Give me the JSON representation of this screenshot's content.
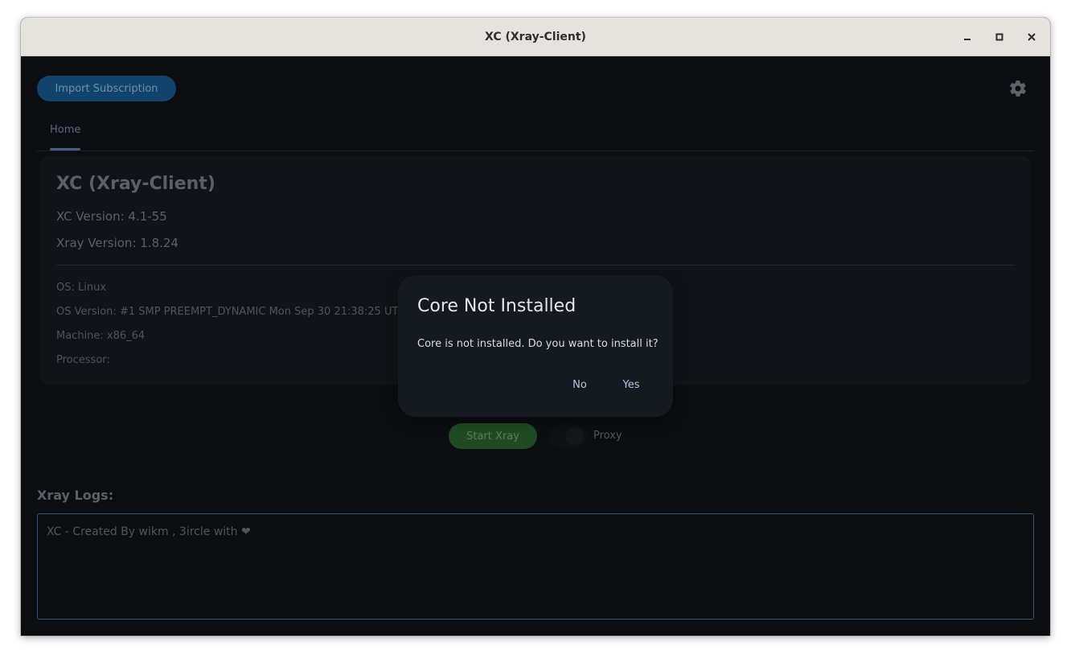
{
  "window": {
    "title": "XC (Xray-Client)"
  },
  "toolbar": {
    "import_label": "Import Subscription",
    "settings_icon": "gear-icon"
  },
  "tabs": [
    {
      "label": "Home",
      "active": true
    }
  ],
  "info_card": {
    "title": "XC (Xray-Client)",
    "xc_version": "XC Version: 4.1-55",
    "xray_version": "Xray Version: 1.8.24",
    "os": "OS: Linux",
    "os_version": "OS Version: #1 SMP PREEMPT_DYNAMIC Mon Sep 30 21:38:25 UTC",
    "machine": "Machine: x86_64",
    "processor": "Processor:"
  },
  "controls": {
    "start_label": "Start Xray",
    "proxy_label": "Proxy",
    "proxy_enabled": false
  },
  "logs": {
    "title": "Xray Logs:",
    "text": "XC - Created By wikm , 3ircle with ❤"
  },
  "dialog": {
    "title": "Core Not Installed",
    "message": "Core is not installed. Do you want to install it?",
    "no_label": "No",
    "yes_label": "Yes"
  },
  "colors": {
    "background": "#0b0d11",
    "accent_blue": "#12436c",
    "accent_green": "#1f4b23",
    "dialog_bg": "#151a21",
    "dialog_button_text": "#a9c9e6"
  }
}
